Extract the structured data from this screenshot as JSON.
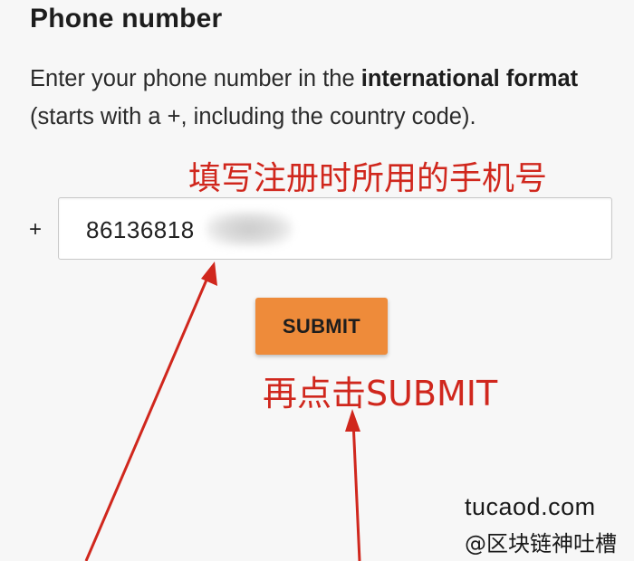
{
  "form": {
    "title": "Phone number",
    "desc_part1": "Enter your phone number in the ",
    "desc_bold1": "international format",
    "desc_part2": " (starts with a +, including the country code).",
    "prefix": "+",
    "phone_value": "86136818",
    "submit_label": "SUBMIT"
  },
  "annotations": {
    "phone_hint": "填写注册时所用的手机号",
    "submit_hint": "再点击SUBMIT"
  },
  "watermark": {
    "domain": "tucaod.com",
    "handle": "@区块链神吐槽"
  },
  "colors": {
    "annotation": "#d0271d",
    "submit_button": "#ee8b3a",
    "background": "#f7f7f7"
  }
}
